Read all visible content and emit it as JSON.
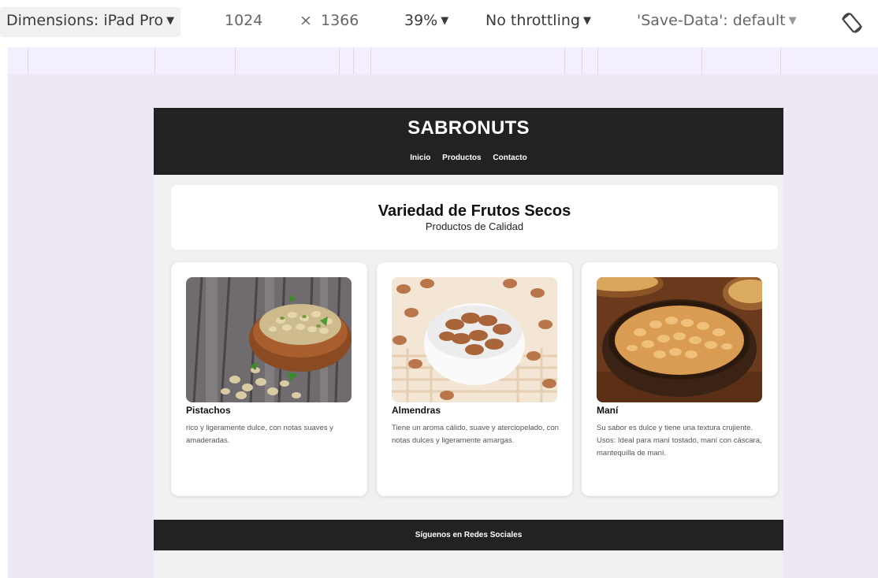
{
  "devtools": {
    "dimensions_label": "Dimensions: iPad Pro",
    "width": "1024",
    "times": "×",
    "height": "1366",
    "zoom": "39%",
    "throttling": "No throttling",
    "save_data": "'Save-Data': default",
    "caret": "▼",
    "caret_light": "▼"
  },
  "site": {
    "title": "SABRONUTS",
    "nav": [
      "Inicio",
      "Productos",
      "Contacto"
    ],
    "hero": {
      "title": "Variedad de Frutos Secos",
      "subtitle": "Productos de Calidad"
    },
    "products": [
      {
        "name": "Pistachos",
        "description": "rico y ligeramente dulce, con notas suaves y amaderadas.",
        "image": "pistachio-bowl"
      },
      {
        "name": "Almendras",
        "description": "Tiene un aroma cálido, suave y aterciopelado, con notas dulces y ligeramente amargas.",
        "image": "almond-bowl"
      },
      {
        "name": "Maní",
        "description": "Su sabor es dulce y tiene una textura crujiente. Usos: Ideal para maní tostado, maní con cáscara, mantequilla de maní.",
        "image": "peanut-bowl"
      }
    ],
    "footer": "Síguenos en Redes Sociales"
  },
  "colors": {
    "header_bg": "#222222",
    "page_bg": "#f1f1f1",
    "device_area_bg": "#eee8f5",
    "media_query_bar": "#f4efff"
  }
}
